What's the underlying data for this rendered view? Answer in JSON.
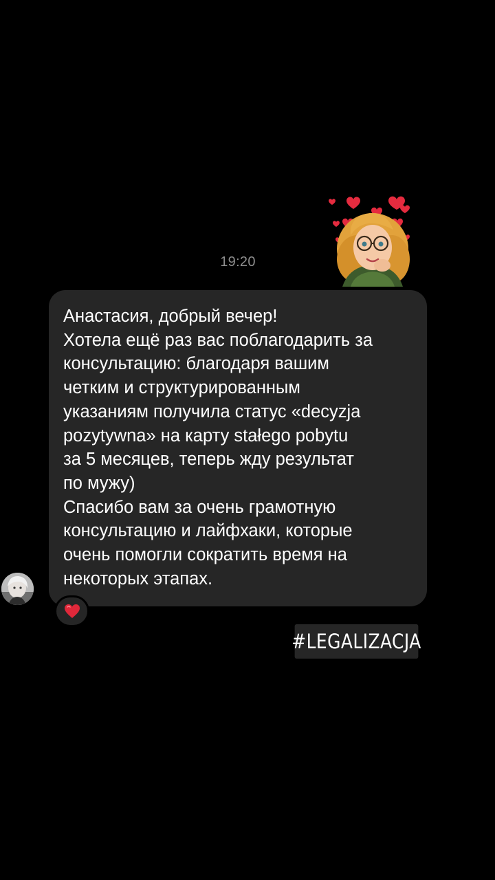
{
  "conversation": {
    "timestamp": "19:20",
    "sticker": {
      "icon": "memoji-heart-sticker-icon",
      "description_colors": {
        "hair": "#e8a33a",
        "heart": "#e0283a",
        "sweater": "#3c5a2a"
      }
    },
    "message": {
      "greeting": "Анастасия, добрый вечер!",
      "body": "Хотела ещё раз вас поблагодарить за\nконсультацию: благодаря вашим\nчетким и структурированным\nуказаниям получила статус «decyzja\npozytywna» на карту stałego pobytu\nза 5 месяцев, теперь жду результат\nпо мужу)",
      "closing": "Спасибо вам за очень грамотную\nконсультацию и лайфхаки, которые\nочень помогли сократить время на\nнекоторых этапах."
    },
    "reaction": {
      "icon": "red-heart-icon",
      "color": "#e0283a"
    },
    "sender_avatar": {
      "icon": "avatar"
    }
  },
  "overlay": {
    "hashtag": "#LEGALIZACJA"
  },
  "colors": {
    "background": "#000000",
    "bubble": "#262626",
    "timestamp": "#8e8e8e"
  }
}
